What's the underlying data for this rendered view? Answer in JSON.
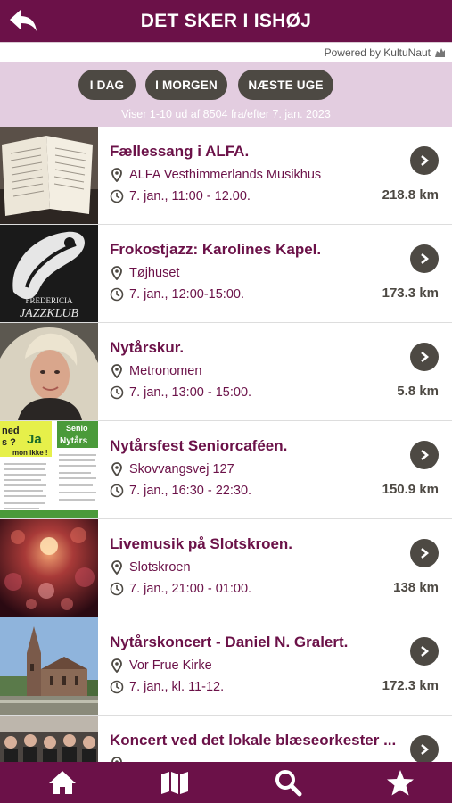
{
  "header": {
    "title": "DET SKER I ISHØJ"
  },
  "powered_by": {
    "text": "Powered by KultuNaut"
  },
  "filters": {
    "buttons": [
      {
        "label": "I DAG"
      },
      {
        "label": "I MORGEN"
      },
      {
        "label": "NÆSTE UGE"
      }
    ],
    "count_text": "Viser 1-10 ud af 8504 fra/efter 7. jan. 2023"
  },
  "events": [
    {
      "title": "Fællessang i ALFA.",
      "location": "ALFA Vesthimmerlands Musikhus",
      "time": "7. jan., 11:00 - 12.00.",
      "distance": "218.8 km",
      "image": "songbook-photo"
    },
    {
      "title": "Frokostjazz: Karolines Kapel.",
      "location": "Tøjhuset",
      "time": "7. jan., 12:00-15:00.",
      "distance": "173.3 km",
      "image": "fredericia-jazzklub-logo"
    },
    {
      "title": "Nytårskur.",
      "location": "Metronomen",
      "time": "7. jan., 13:00 - 15:00.",
      "distance": "5.8 km",
      "image": "woman-portrait"
    },
    {
      "title": "Nytårsfest Seniorcaféen.",
      "location": "Skovvangsvej 127",
      "time": "7. jan., 16:30 - 22:30.",
      "distance": "150.9 km",
      "image": "senior-poster"
    },
    {
      "title": "Livemusik på Slotskroen.",
      "location": "Slotskroen",
      "time": "7. jan., 21:00 - 01:00.",
      "distance": "138 km",
      "image": "red-bokeh-lights"
    },
    {
      "title": "Nytårskoncert - Daniel N. Gralert.",
      "location": "Vor Frue Kirke",
      "time": "7. jan., kl. 11-12.",
      "distance": "172.3 km",
      "image": "church-photo"
    },
    {
      "title": "Koncert ved det lokale blæseorkester ...",
      "location": "",
      "time": "",
      "distance": "",
      "image": "orchestra-photo"
    }
  ],
  "poster_text": {
    "line1": "ned",
    "line2": "s ?",
    "line3": "Ja",
    "line4": "mon ikke !",
    "line5": "Senio",
    "line6": "Nytårs"
  },
  "logo_text": {
    "line1": "FREDERICIA",
    "line2": "JAZZKLUB"
  },
  "tabbar": {
    "items": [
      {
        "icon": "home-icon"
      },
      {
        "icon": "map-icon"
      },
      {
        "icon": "search-icon"
      },
      {
        "icon": "star-icon"
      }
    ]
  },
  "colors": {
    "brand": "#6b1148",
    "button": "#4d4943",
    "filter_bg": "#e3cde0"
  }
}
